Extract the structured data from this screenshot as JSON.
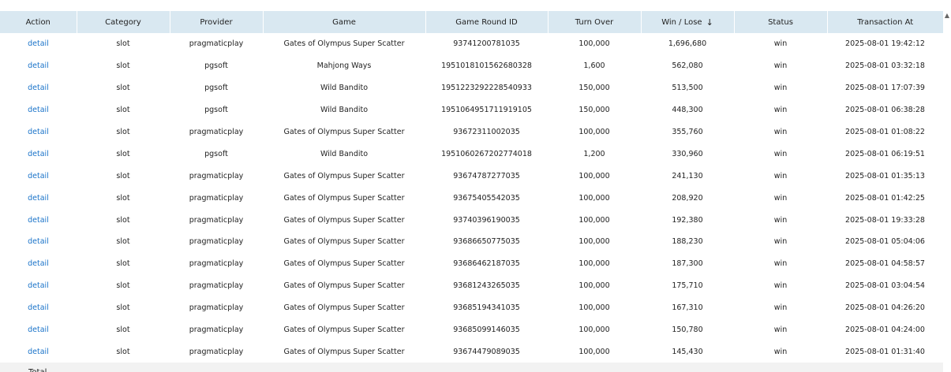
{
  "table": {
    "headers": [
      "Action",
      "Category",
      "Provider",
      "Game",
      "Game Round ID",
      "Turn Over",
      "Win / Lose",
      "Status",
      "Transaction At"
    ],
    "sort_icon": "arrow-down-icon",
    "rows": [
      [
        "detail",
        "slot",
        "pragmaticplay",
        "Gates of Olympus Super Scatter",
        "93741200781035",
        "100,000",
        "1,696,680",
        "win",
        "2025-08-01 19:42:12"
      ],
      [
        "detail",
        "slot",
        "pgsoft",
        "Mahjong Ways",
        "1951018101562680328",
        "1,600",
        "562,080",
        "win",
        "2025-08-01 03:32:18"
      ],
      [
        "detail",
        "slot",
        "pgsoft",
        "Wild Bandito",
        "1951223292228540933",
        "150,000",
        "513,500",
        "win",
        "2025-08-01 17:07:39"
      ],
      [
        "detail",
        "slot",
        "pgsoft",
        "Wild Bandito",
        "1951064951711919105",
        "150,000",
        "448,300",
        "win",
        "2025-08-01 06:38:28"
      ],
      [
        "detail",
        "slot",
        "pragmaticplay",
        "Gates of Olympus Super Scatter",
        "93672311002035",
        "100,000",
        "355,760",
        "win",
        "2025-08-01 01:08:22"
      ],
      [
        "detail",
        "slot",
        "pgsoft",
        "Wild Bandito",
        "1951060267202774018",
        "1,200",
        "330,960",
        "win",
        "2025-08-01 06:19:51"
      ],
      [
        "detail",
        "slot",
        "pragmaticplay",
        "Gates of Olympus Super Scatter",
        "93674787277035",
        "100,000",
        "241,130",
        "win",
        "2025-08-01 01:35:13"
      ],
      [
        "detail",
        "slot",
        "pragmaticplay",
        "Gates of Olympus Super Scatter",
        "93675405542035",
        "100,000",
        "208,920",
        "win",
        "2025-08-01 01:42:25"
      ],
      [
        "detail",
        "slot",
        "pragmaticplay",
        "Gates of Olympus Super Scatter",
        "93740396190035",
        "100,000",
        "192,380",
        "win",
        "2025-08-01 19:33:28"
      ],
      [
        "detail",
        "slot",
        "pragmaticplay",
        "Gates of Olympus Super Scatter",
        "93686650775035",
        "100,000",
        "188,230",
        "win",
        "2025-08-01 05:04:06"
      ],
      [
        "detail",
        "slot",
        "pragmaticplay",
        "Gates of Olympus Super Scatter",
        "93686462187035",
        "100,000",
        "187,300",
        "win",
        "2025-08-01 04:58:57"
      ],
      [
        "detail",
        "slot",
        "pragmaticplay",
        "Gates of Olympus Super Scatter",
        "93681243265035",
        "100,000",
        "175,710",
        "win",
        "2025-08-01 03:04:54"
      ],
      [
        "detail",
        "slot",
        "pragmaticplay",
        "Gates of Olympus Super Scatter",
        "93685194341035",
        "100,000",
        "167,310",
        "win",
        "2025-08-01 04:26:20"
      ],
      [
        "detail",
        "slot",
        "pragmaticplay",
        "Gates of Olympus Super Scatter",
        "93685099146035",
        "100,000",
        "150,780",
        "win",
        "2025-08-01 04:24:00"
      ],
      [
        "detail",
        "slot",
        "pragmaticplay",
        "Gates of Olympus Super Scatter",
        "93674479089035",
        "100,000",
        "145,430",
        "win",
        "2025-08-01 01:31:40"
      ]
    ],
    "footer": {
      "label": "Total"
    }
  },
  "colors": {
    "header_bg": "#d9e8f1",
    "link": "#1a73c9",
    "footer_bg": "#f2f2f2"
  },
  "scroll_icon": "scroll-up-arrow-icon"
}
